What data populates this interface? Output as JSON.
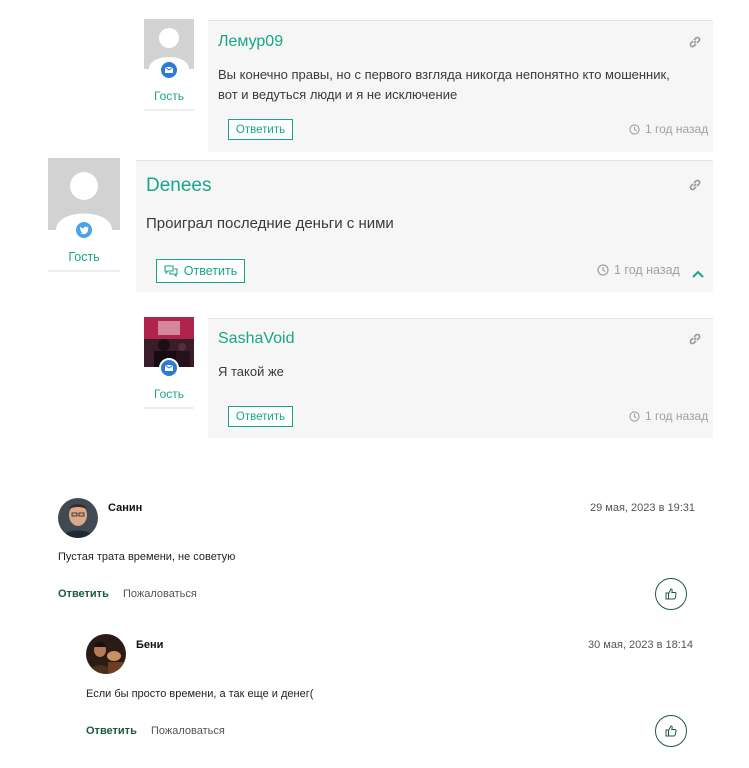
{
  "comments": [
    {
      "author": "Лемур09",
      "text_line1": "Вы конечно правы, но с первого взгляда никогда непонятно кто мошенник,",
      "text_line2": "вот и ведуться люди и я не исключение",
      "role": "Гость",
      "reply_label": "Ответить",
      "time": "1 год назад",
      "badge_icon": "envelope-icon"
    },
    {
      "author": "Denees",
      "text": "Проиграл последние деньги с ними",
      "role": "Гость",
      "reply_label": "Ответить",
      "time": "1 год назад",
      "badge_icon": "twitter-icon"
    },
    {
      "author": "SashaVoid",
      "text": "Я такой же",
      "role": "Гость",
      "reply_label": "Ответить",
      "time": "1 год назад",
      "badge_icon": "envelope-icon"
    }
  ],
  "reviews": [
    {
      "name": "Санин",
      "date": "29 мая, 2023 в 19:31",
      "text": "Пустая трата времени, не советую",
      "reply_label": "Ответить",
      "report_label": "Пожаловаться"
    },
    {
      "name": "Бени",
      "date": "30 мая, 2023 в 18:14",
      "text": "Если бы просто времени, а так еще и денег(",
      "reply_label": "Ответить",
      "report_label": "Пожаловаться"
    }
  ],
  "colors": {
    "accent": "#17a689",
    "dark_green": "#1c5b3c",
    "card_bg": "#f6f6f6"
  }
}
